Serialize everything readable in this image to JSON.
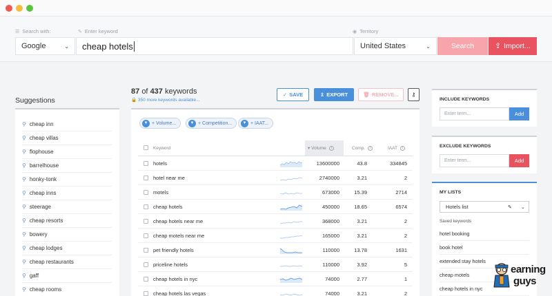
{
  "search": {
    "search_with_label": "Search with:",
    "keyword_label": "Enter keyword",
    "territory_label": "Territory",
    "engine": "Google",
    "keyword": "cheap hotels",
    "territory": "United States",
    "search_button": "Search",
    "import_button": "Import..."
  },
  "suggestions": {
    "title": "Suggestions",
    "items": [
      "cheap inn",
      "cheap villas",
      "flophouse",
      "barrelhouse",
      "honky-tonk",
      "cheap inns",
      "steerage",
      "cheap resorts",
      "bowery",
      "cheap lodges",
      "cheap restaurants",
      "gaff",
      "cheap rooms"
    ]
  },
  "results": {
    "count_shown": "87",
    "count_of": "of",
    "count_total": "437",
    "count_suffix": "keywords",
    "more_available": "350 more keywords available...",
    "toolbar": {
      "save": "SAVE",
      "export": "EXPORT",
      "remove": "REMOVE..."
    },
    "filters": [
      "+ Volume...",
      "+ Competition...",
      "+ IAAT..."
    ],
    "columns": {
      "keyword": "Keyword",
      "volume": "Volume",
      "comp": "Comp.",
      "iaat": "IAAT"
    },
    "rows": [
      {
        "keyword": "hotels",
        "volume": "13600000",
        "comp": "43.8",
        "iaat": "334845"
      },
      {
        "keyword": "hotel near me",
        "volume": "2740000",
        "comp": "3.21",
        "iaat": "2"
      },
      {
        "keyword": "motels",
        "volume": "673000",
        "comp": "15.39",
        "iaat": "2714"
      },
      {
        "keyword": "cheap hotels",
        "volume": "450000",
        "comp": "18.65",
        "iaat": "6574"
      },
      {
        "keyword": "cheap hotels near me",
        "volume": "368000",
        "comp": "3.21",
        "iaat": "2"
      },
      {
        "keyword": "cheap motels near me",
        "volume": "165000",
        "comp": "3.21",
        "iaat": "2"
      },
      {
        "keyword": "pet friendly hotels",
        "volume": "110000",
        "comp": "13.78",
        "iaat": "1631"
      },
      {
        "keyword": "priceline hotels",
        "volume": "110000",
        "comp": "3.92",
        "iaat": "5"
      },
      {
        "keyword": "cheap hotels in nyc",
        "volume": "74000",
        "comp": "2.77",
        "iaat": "1"
      },
      {
        "keyword": "cheap hotels las vegas",
        "volume": "74000",
        "comp": "3.21",
        "iaat": "2"
      }
    ]
  },
  "include": {
    "title": "INCLUDE KEYWORDS",
    "placeholder": "Enter term...",
    "add": "Add"
  },
  "exclude": {
    "title": "EXCLUDE KEYWORDS",
    "placeholder": "Enter term...",
    "add": "Add"
  },
  "lists": {
    "title": "MY LISTS",
    "selected": "Hotels list",
    "saved_label": "Saved keywords",
    "items": [
      "hotel booking",
      "book hotel",
      "extended stay hotels",
      "cheap motels",
      "cheap hotels in nyc"
    ]
  },
  "logo": {
    "line1": "earning",
    "line2": "guys"
  },
  "colors": {
    "accent_red": "#e9525f",
    "accent_pink": "#f7a4ab",
    "accent_blue": "#4a8fdc"
  }
}
